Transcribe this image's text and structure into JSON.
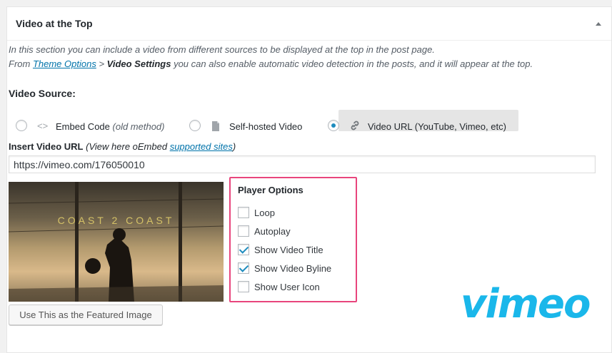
{
  "panel": {
    "title": "Video at the Top"
  },
  "description": {
    "line1": "In this section you can include a video from different sources to be displayed at the top in the post page.",
    "line2_prefix": "From ",
    "line2_link": "Theme Options",
    "line2_sep": " > ",
    "line2_bold": "Video Settings",
    "line2_suffix": " you can also enable automatic video detection in the posts, and it will appear at the top."
  },
  "video_source": {
    "label": "Video Source:",
    "options": [
      {
        "label": "Embed Code",
        "note": "(old method)",
        "icon": "code-icon",
        "selected": false
      },
      {
        "label": "Self-hosted Video",
        "note": "",
        "icon": "file-icon",
        "selected": false
      },
      {
        "label": "Video URL (YouTube, Vimeo, etc)",
        "note": "",
        "icon": "link-icon",
        "selected": true
      }
    ]
  },
  "url_field": {
    "label": "Insert Video URL",
    "hint_prefix": "(View here oEmbed ",
    "hint_link": "supported sites",
    "hint_suffix": ")",
    "value": "https://vimeo.com/176050010"
  },
  "thumbnail": {
    "overlay_text": "COAST 2 COAST"
  },
  "featured_button": {
    "label": "Use This as the Featured Image"
  },
  "player_options": {
    "title": "Player Options",
    "items": [
      {
        "label": "Loop",
        "checked": false
      },
      {
        "label": "Autoplay",
        "checked": false
      },
      {
        "label": "Show Video Title",
        "checked": true
      },
      {
        "label": "Show Video Byline",
        "checked": true
      },
      {
        "label": "Show User Icon",
        "checked": false
      }
    ]
  },
  "logo": {
    "text": "vimeo",
    "color": "#1ab7ea"
  }
}
